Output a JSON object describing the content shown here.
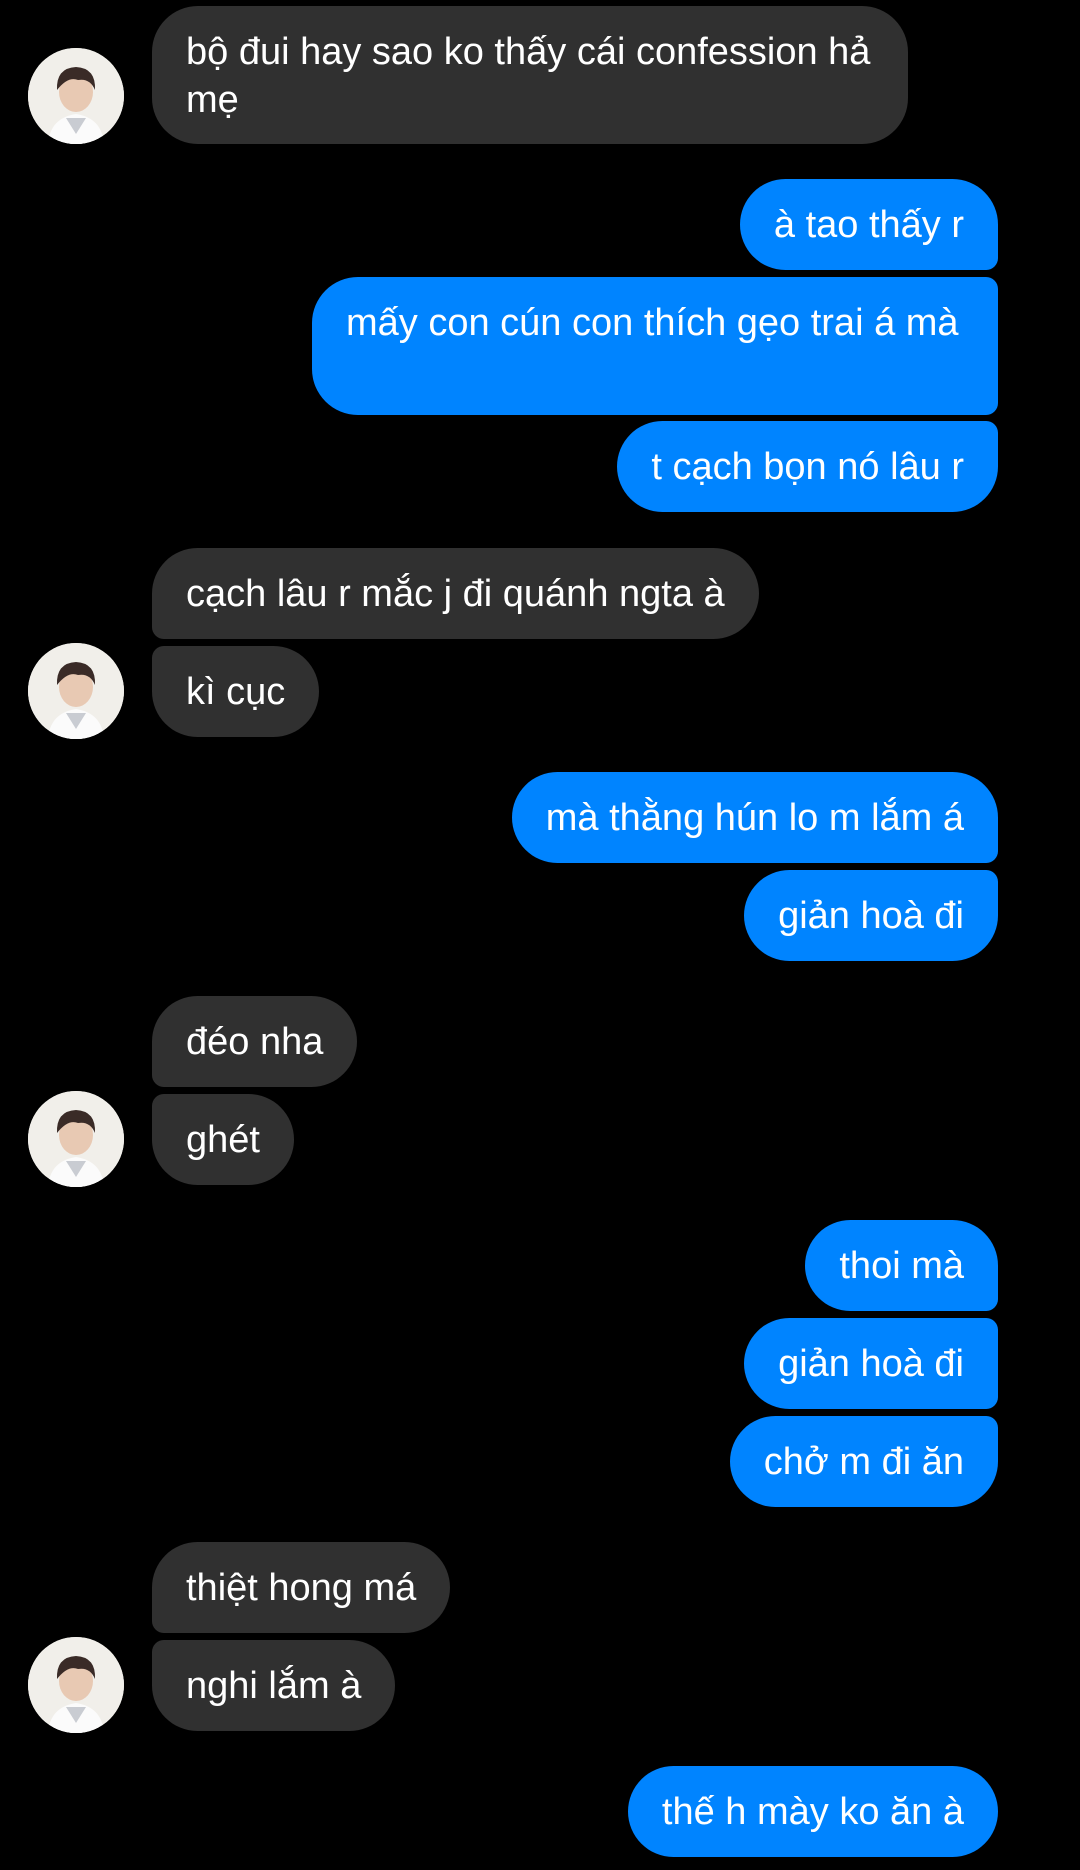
{
  "conversation": {
    "messages": [
      {
        "text": "bộ đui hay sao ko thấy cái confession hả mẹ"
      },
      {
        "text": "à tao thấy r"
      },
      {
        "text": "mấy con cún con thích gẹo trai á mà"
      },
      {
        "text": "t cạch bọn nó lâu r"
      },
      {
        "text": "cạch lâu r mắc j đi quánh ngta à"
      },
      {
        "text": "kì cục"
      },
      {
        "text": "mà thằng hún lo m lắm á"
      },
      {
        "text": "giản hoà đi"
      },
      {
        "text": "đéo nha"
      },
      {
        "text": "ghét"
      },
      {
        "text": "thoi mà"
      },
      {
        "text": "giản hoà đi"
      },
      {
        "text": "chở m đi ăn"
      },
      {
        "text": "thiệt hong má"
      },
      {
        "text": "nghi lắm à"
      },
      {
        "text": "thế h mày ko ăn à"
      }
    ]
  },
  "colors": {
    "background": "#000000",
    "incoming_bubble": "#303030",
    "outgoing_bubble": "#0084ff",
    "text": "#ffffff"
  },
  "icons": {
    "avatar": "contact-avatar-photo"
  }
}
